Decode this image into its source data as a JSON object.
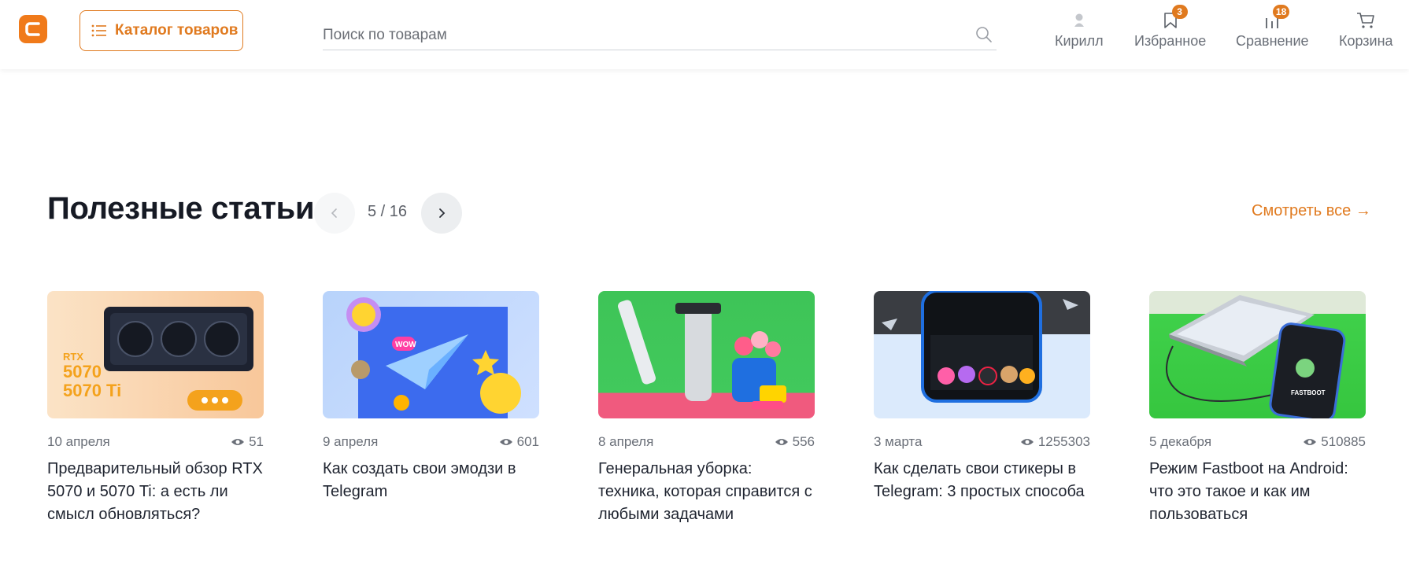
{
  "header": {
    "catalog_label": "Каталог товаров",
    "search_placeholder": "Поиск по товарам",
    "nav": {
      "profile": "Кирилл",
      "favorites": "Избранное",
      "favorites_badge": "3",
      "compare": "Сравнение",
      "compare_badge": "18",
      "cart": "Корзина"
    }
  },
  "section": {
    "title": "Полезные статьи",
    "pager": "5 / 16",
    "see_all": "Смотреть все →"
  },
  "articles": [
    {
      "date": "10 апреля",
      "views": "51",
      "title": "Предварительный обзор RTX 5070 и 5070 Ti: а есть ли смысл обновляться?",
      "thumb_text_1": "RTX",
      "thumb_text_2": "5070",
      "thumb_text_3": "5070 Ti"
    },
    {
      "date": "9 апреля",
      "views": "601",
      "title": "Как создать свои эмодзи в Telegram",
      "thumb_text_1": "WOW"
    },
    {
      "date": "8 апреля",
      "views": "556",
      "title": "Генеральная уборка: техника, которая справится с любыми задачами"
    },
    {
      "date": "3 марта",
      "views": "1255303",
      "title": "Как сделать свои стикеры в Telegram: 3 простых способа"
    },
    {
      "date": "5 декабря",
      "views": "510885",
      "title": "Режим Fastboot на Android: что это такое и как им пользоваться",
      "thumb_text_1": "FASTBOOT"
    }
  ],
  "colors": {
    "accent": "#e07a1f",
    "text": "#1f2430",
    "muted": "#6a6f78"
  }
}
